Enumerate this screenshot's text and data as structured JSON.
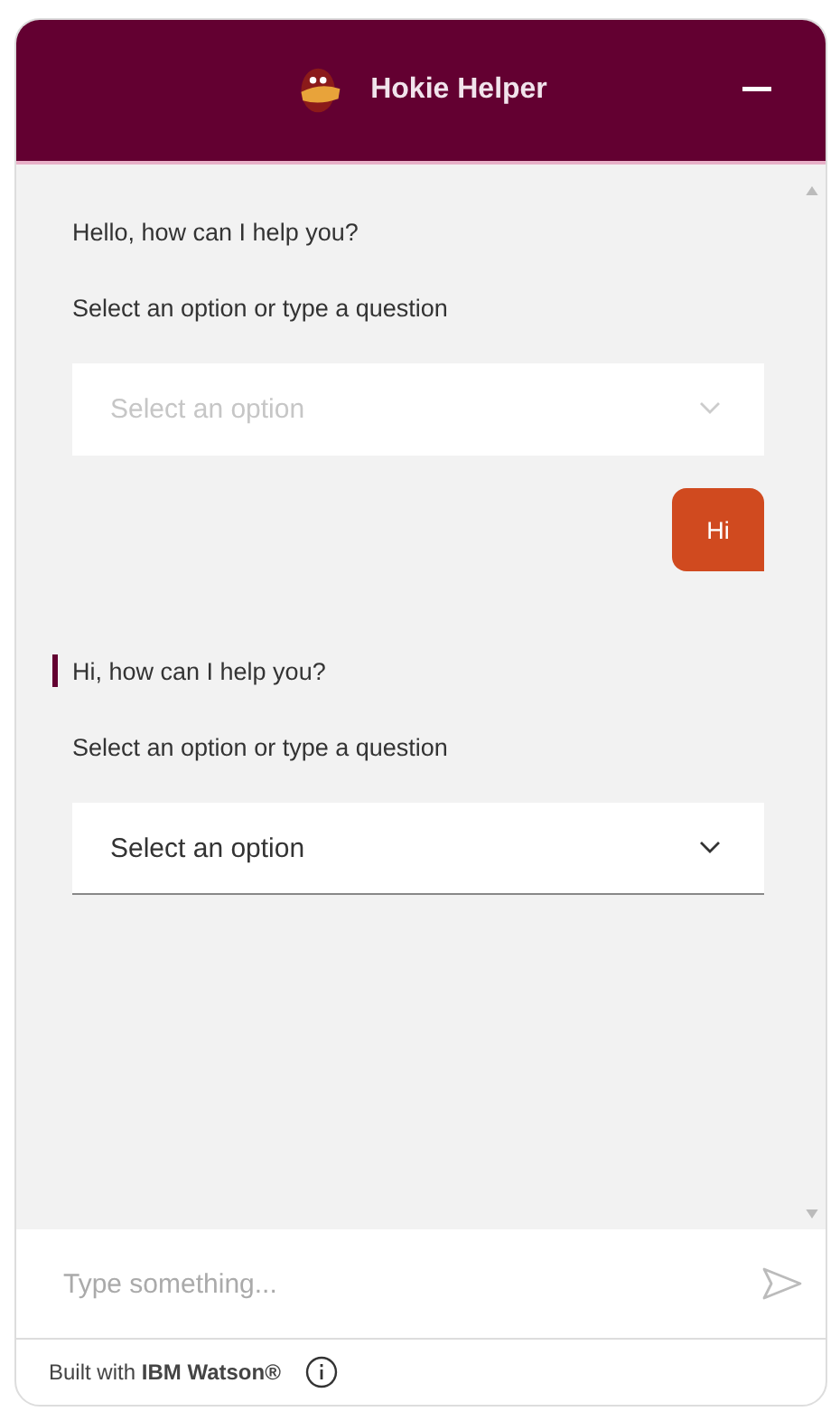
{
  "header": {
    "title": "Hokie Helper"
  },
  "messages": [
    {
      "kind": "bot",
      "highlighted": false,
      "text": "Hello, how can I help you?",
      "prompt": "Select an option or type a question",
      "dropdown": {
        "placeholder": "Select an option",
        "disabled": true
      }
    },
    {
      "kind": "user",
      "text": "Hi"
    },
    {
      "kind": "bot",
      "highlighted": true,
      "text": "Hi, how can I help you?",
      "prompt": "Select an option or type a question",
      "dropdown": {
        "placeholder": "Select an option",
        "disabled": false
      }
    }
  ],
  "input": {
    "placeholder": "Type something..."
  },
  "footer": {
    "text": "Built with **IBM Watson®**"
  }
}
